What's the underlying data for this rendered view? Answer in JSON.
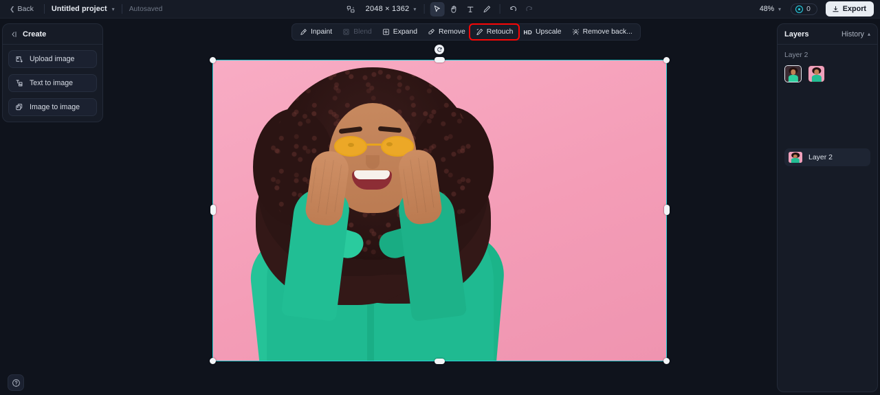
{
  "topbar": {
    "back_label": "Back",
    "project_name": "Untitled project",
    "autosaved_label": "Autosaved",
    "canvas_dimensions": "2048 × 1362",
    "zoom_level": "48%",
    "credits_count": "0",
    "export_label": "Export",
    "tools": [
      {
        "name": "frame-icon",
        "label": "Frame"
      },
      {
        "name": "select-tool",
        "label": "Select",
        "active": true
      },
      {
        "name": "hand-tool",
        "label": "Hand"
      },
      {
        "name": "text-tool",
        "label": "Text"
      },
      {
        "name": "brush-tool",
        "label": "Brush"
      },
      {
        "name": "undo-button",
        "label": "Undo"
      },
      {
        "name": "redo-button",
        "label": "Redo",
        "disabled": true
      }
    ]
  },
  "create_panel": {
    "title": "Create",
    "items": [
      {
        "label": "Upload image",
        "icon": "upload-image-icon"
      },
      {
        "label": "Text to image",
        "icon": "text-to-image-icon"
      },
      {
        "label": "Image to image",
        "icon": "image-to-image-icon"
      }
    ]
  },
  "action_toolbar": {
    "items": [
      {
        "label": "Inpaint",
        "icon": "inpaint-icon",
        "disabled": false,
        "highlighted": false
      },
      {
        "label": "Blend",
        "icon": "blend-icon",
        "disabled": true,
        "highlighted": false
      },
      {
        "label": "Expand",
        "icon": "expand-icon",
        "disabled": false,
        "highlighted": false
      },
      {
        "label": "Remove",
        "icon": "remove-icon",
        "disabled": false,
        "highlighted": false
      },
      {
        "label": "Retouch",
        "icon": "retouch-icon",
        "disabled": false,
        "highlighted": true
      },
      {
        "label": "Upscale",
        "icon": "hd-badge",
        "disabled": false,
        "highlighted": false
      },
      {
        "label": "Remove back...",
        "icon": "remove-background-icon",
        "disabled": false,
        "highlighted": false
      }
    ],
    "highlight_color": "#fb0606"
  },
  "layers_panel": {
    "title": "Layers",
    "history_label": "History",
    "section_title": "Layer 2",
    "layers": [
      {
        "name": "Layer 2"
      }
    ]
  },
  "canvas": {
    "selection_color": "#27cfd4",
    "background_color": "#0f131c",
    "image_description": "Smiling woman with curly dark hair, yellow tinted sunglasses, green shirt, hands on cheeks, pink background"
  },
  "help": {
    "label": "?"
  }
}
